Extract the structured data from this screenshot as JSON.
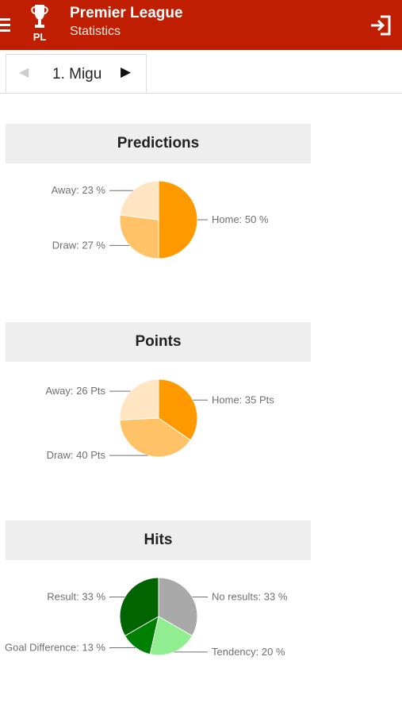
{
  "app": {
    "title": "Premier League",
    "subtitle": "Statistics",
    "logo_text": "PL",
    "icons": {
      "menu": "menu-icon",
      "logo": "trophy-icon",
      "logout": "logout-icon"
    },
    "colors": {
      "appbar": "#c01e00",
      "header_bg": "#eeeeee"
    }
  },
  "tab": {
    "prev_icon": "◀",
    "label": "1. Migu",
    "next_icon": "▶"
  },
  "sections": [
    {
      "title": "Predictions"
    },
    {
      "title": "Points"
    },
    {
      "title": "Hits"
    }
  ],
  "chart_data": [
    {
      "type": "pie",
      "title": "Predictions",
      "slices": [
        {
          "label": "Home: 50 %",
          "value": 50,
          "color": "#ff9900"
        },
        {
          "label": "Draw: 27 %",
          "value": 27,
          "color": "#ffc266"
        },
        {
          "label": "Away: 23 %",
          "value": 23,
          "color": "#ffe5c2"
        }
      ]
    },
    {
      "type": "pie",
      "title": "Points",
      "slices": [
        {
          "label": "Home: 35 Pts",
          "value": 35,
          "color": "#ff9900"
        },
        {
          "label": "Draw: 40 Pts",
          "value": 40,
          "color": "#ffc266"
        },
        {
          "label": "Away: 26 Pts",
          "value": 26,
          "color": "#ffe5c2"
        }
      ]
    },
    {
      "type": "pie",
      "title": "Hits",
      "slices": [
        {
          "label": "No results: 33 %",
          "value": 33,
          "color": "#a9a9a9"
        },
        {
          "label": "Tendency: 20 %",
          "value": 20,
          "color": "#90ee90"
        },
        {
          "label": "Goal Difference: 13 %",
          "value": 13,
          "color": "#008000"
        },
        {
          "label": "Result: 33 %",
          "value": 33,
          "color": "#006400"
        }
      ]
    }
  ]
}
